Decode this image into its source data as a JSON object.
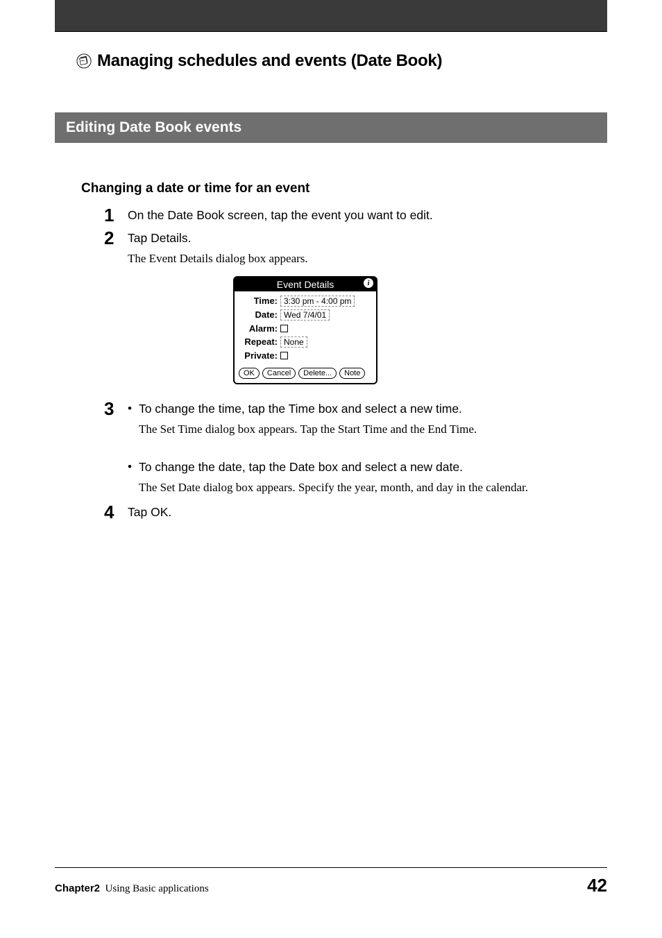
{
  "chapter_heading": "Managing schedules and events (Date Book)",
  "section_title": "Editing Date Book events",
  "sub_heading": "Changing a date or time for an event",
  "steps": {
    "s1": {
      "num": "1",
      "line": "On the Date Book screen, tap the event you want to edit."
    },
    "s2": {
      "num": "2",
      "line": "Tap Details.",
      "sub": "The Event Details dialog box appears."
    },
    "s3": {
      "num": "3",
      "bullet1_line": "To change the time, tap the Time box and select a new time.",
      "bullet1_sub": "The Set Time dialog box appears. Tap the Start Time and the End Time.",
      "bullet2_line": "To change the date, tap the Date box and select a new date.",
      "bullet2_sub": "The Set Date dialog box appears. Specify the year, month, and day in the calendar."
    },
    "s4": {
      "num": "4",
      "line": "Tap OK."
    }
  },
  "dialog": {
    "title": "Event Details",
    "time_label": "Time:",
    "time_value": "3:30 pm - 4:00 pm",
    "date_label": "Date:",
    "date_value": "Wed 7/4/01",
    "alarm_label": "Alarm:",
    "repeat_label": "Repeat:",
    "repeat_value": "None",
    "private_label": "Private:",
    "btn_ok": "OK",
    "btn_cancel": "Cancel",
    "btn_delete": "Delete...",
    "btn_note": "Note"
  },
  "footer": {
    "chapter_label": "Chapter2",
    "chapter_text": "Using Basic applications",
    "page_number": "42"
  }
}
